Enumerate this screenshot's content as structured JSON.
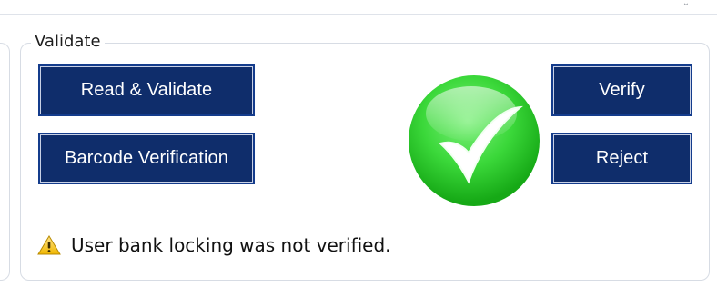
{
  "window": {
    "group_title": "Validate"
  },
  "buttons": {
    "read_validate": "Read & Validate",
    "barcode_verification": "Barcode Verification",
    "verify": "Verify",
    "reject": "Reject"
  },
  "status": {
    "icon_name": "success-check-icon",
    "accent_color": "#2fd12f"
  },
  "warning": {
    "icon_name": "warning-icon",
    "text": "User bank locking was not verified."
  }
}
